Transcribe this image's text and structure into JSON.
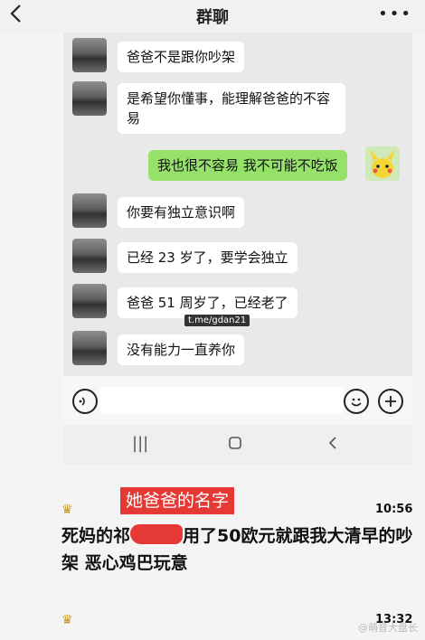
{
  "header": {
    "title": "群聊",
    "more": "•••"
  },
  "messages": [
    {
      "side": "left",
      "text": "爸爸不是跟你吵架"
    },
    {
      "side": "left",
      "text": "是希望你懂事，能理解爸爸的不容易"
    },
    {
      "side": "right",
      "text": "我也很不容易 我不可能不吃饭"
    },
    {
      "side": "left",
      "text": "你要有独立意识啊"
    },
    {
      "side": "left",
      "text": "已经 23 岁了，要学会独立"
    },
    {
      "side": "left",
      "text": "爸爸 51 周岁了，已经老了"
    },
    {
      "side": "left",
      "text": "没有能力一直养你"
    }
  ],
  "inner_watermark": "t.me/gdan21",
  "overlay_label": "她爸爸的名字",
  "time1": "10:56",
  "post_text_before": "死妈的祁",
  "post_text_after": "用了50欧元就跟我大清早的吵架 恶心鸡巴玩意",
  "time2": "13:32",
  "footer_watermark": "@萌音大盘长",
  "colors": {
    "green_bubble": "#95e16a",
    "redact": "#e53935"
  }
}
